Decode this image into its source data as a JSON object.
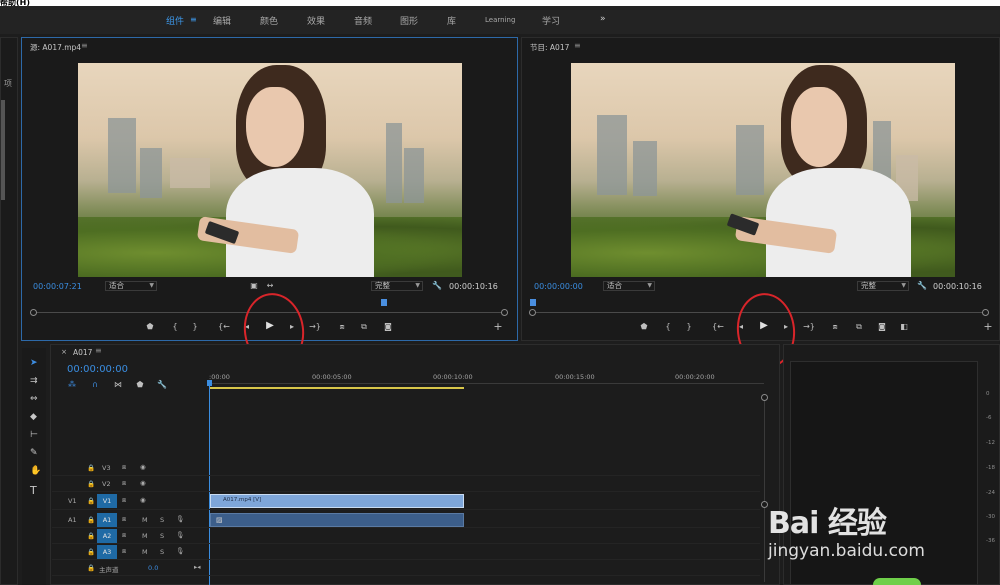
{
  "menu": {
    "help": "帮助(H)"
  },
  "workspaces": {
    "tabs": [
      "组件",
      "编辑",
      "颜色",
      "效果",
      "音频",
      "图形",
      "库",
      "Learning",
      "学习"
    ],
    "active_index": 0,
    "more": "»"
  },
  "left_panel": {
    "project_label": "项"
  },
  "source_monitor": {
    "title": "源: A017.mp4",
    "timecode_current": "00:00:07:21",
    "fit_label": "适合",
    "quality_label": "完整",
    "timecode_duration": "00:00:10:16",
    "progress": 0.74
  },
  "program_monitor": {
    "title": "节目: A017",
    "timecode_current": "00:00:00:00",
    "fit_label": "适合",
    "quality_label": "完整",
    "timecode_duration": "00:00:10:16",
    "progress": 0.0
  },
  "timeline": {
    "sequence_name": "A017",
    "timecode": "00:00:00:00",
    "ruler_labels": [
      ":00:00",
      "00:00:05:00",
      "00:00:10:00",
      "00:00:15:00",
      "00:00:20:00"
    ],
    "tracks": [
      {
        "source": "",
        "target": "V3",
        "type": "video"
      },
      {
        "source": "",
        "target": "V2",
        "type": "video"
      },
      {
        "source": "V1",
        "target": "V1",
        "type": "video",
        "clip": "A017.mp4 [V]"
      },
      {
        "source": "A1",
        "target": "A1",
        "type": "audio",
        "m": "M",
        "s": "S"
      },
      {
        "source": "",
        "target": "A2",
        "type": "audio",
        "m": "M",
        "s": "S"
      },
      {
        "source": "",
        "target": "A3",
        "type": "audio",
        "m": "M",
        "s": "S"
      }
    ],
    "master": {
      "label": "主声道",
      "value": "0.0"
    }
  },
  "meters": {
    "labels": [
      "0",
      "-6",
      "-12",
      "-18",
      "-24",
      "-30",
      "-36"
    ]
  },
  "watermark": {
    "main": "Bai 经验",
    "sub": "jingyan.baidu.com"
  },
  "colors": {
    "accent": "#3d97e8",
    "annotation": "#d8252a",
    "track_target": "#1f6aa5",
    "clip_video": "#7ea6d9"
  }
}
